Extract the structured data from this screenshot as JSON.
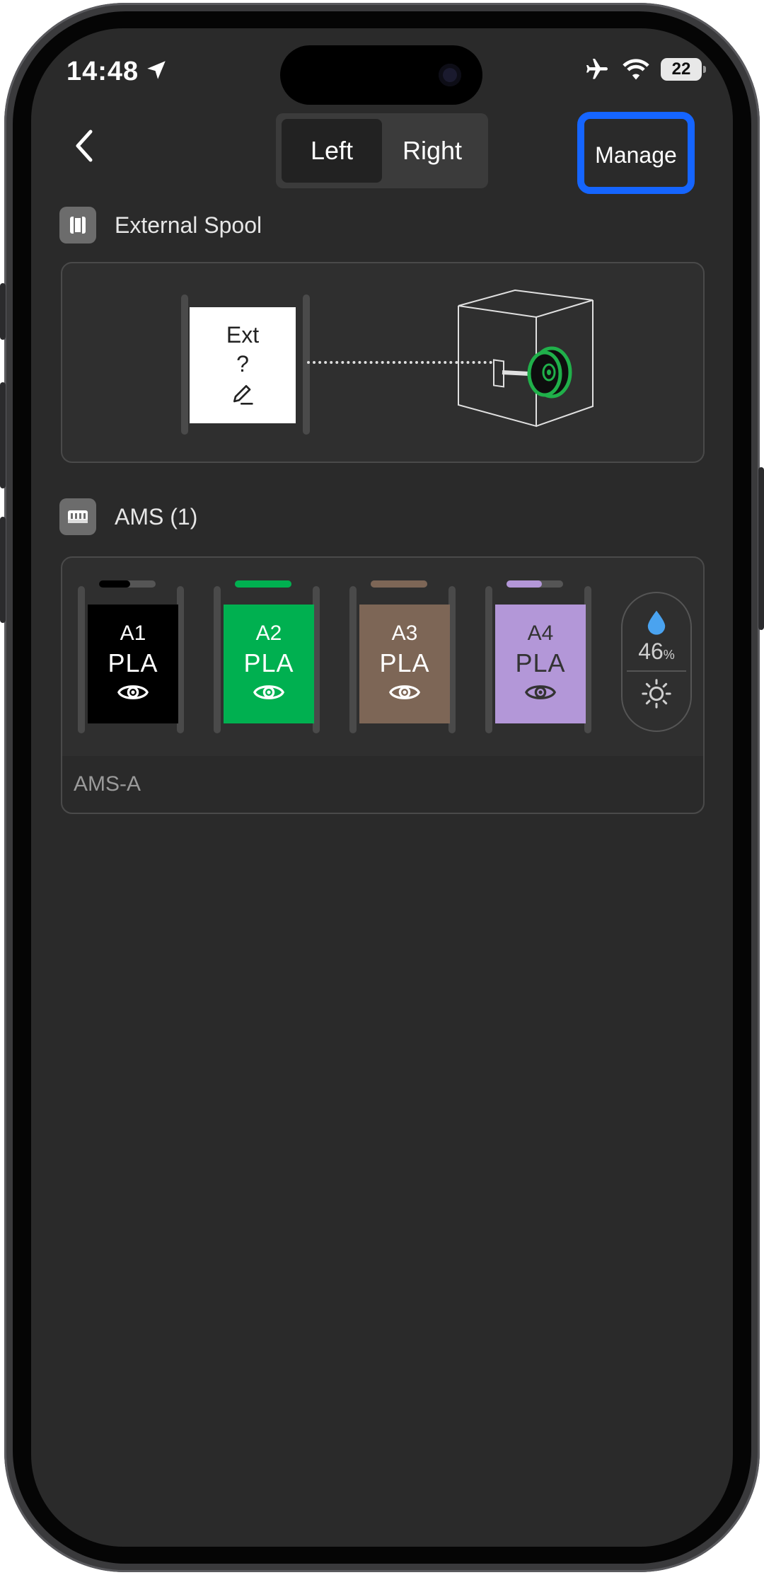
{
  "status": {
    "time": "14:48",
    "battery": "22"
  },
  "header": {
    "segments": [
      "Left",
      "Right"
    ],
    "active_segment": "Left",
    "manage_label": "Manage"
  },
  "external_spool": {
    "title": "External Spool",
    "slot_label": "Ext",
    "slot_material": "?"
  },
  "ams": {
    "title": "AMS (1)",
    "unit_name": "AMS-A",
    "humidity": "46",
    "humidity_unit": "%",
    "slots": [
      {
        "id": "A1",
        "material": "PLA",
        "color": "#000000",
        "text_color": "#ffffff",
        "remaining_fraction": 0.55
      },
      {
        "id": "A2",
        "material": "PLA",
        "color": "#00b050",
        "text_color": "#ffffff",
        "remaining_fraction": 1.0
      },
      {
        "id": "A3",
        "material": "PLA",
        "color": "#7d6656",
        "text_color": "#ffffff",
        "remaining_fraction": 1.0
      },
      {
        "id": "A4",
        "material": "PLA",
        "color": "#b397d8",
        "text_color": "#333333",
        "remaining_fraction": 0.62
      }
    ]
  },
  "colors": {
    "accent_highlight": "#1565ff",
    "humidity_drop": "#4aa3f0"
  }
}
